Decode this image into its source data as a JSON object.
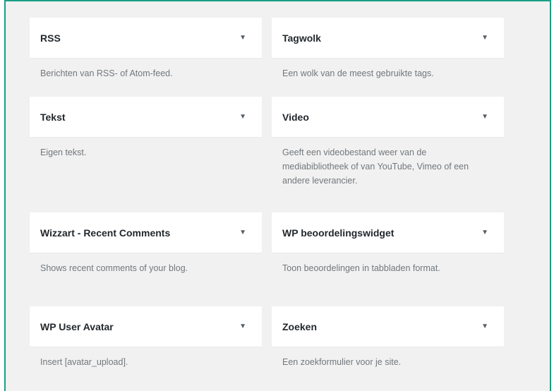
{
  "widgets": [
    {
      "title": "RSS",
      "description": "Berichten van RSS- of Atom-feed."
    },
    {
      "title": "Tagwolk",
      "description": "Een wolk van de meest gebruikte tags."
    },
    {
      "title": "Tekst",
      "description": "Eigen tekst."
    },
    {
      "title": "Video",
      "description": "Geeft een videobestand weer van de mediabibliotheek of van YouTube, Vimeo of een andere leverancier."
    },
    {
      "title": "Wizzart - Recent Comments",
      "description": "Shows recent comments of your blog."
    },
    {
      "title": "WP beoordelingswidget",
      "description": "Toon beoordelingen in tabbladen format."
    },
    {
      "title": "WP User Avatar",
      "description": "Insert [avatar_upload]."
    },
    {
      "title": "Zoeken",
      "description": "Een zoekformulier voor je site."
    }
  ],
  "arrow_glyph": "▼",
  "colors": {
    "frame_border": "#18a085",
    "panel_bg": "#f1f1f1",
    "title": "#23282d",
    "description": "#72777c"
  }
}
